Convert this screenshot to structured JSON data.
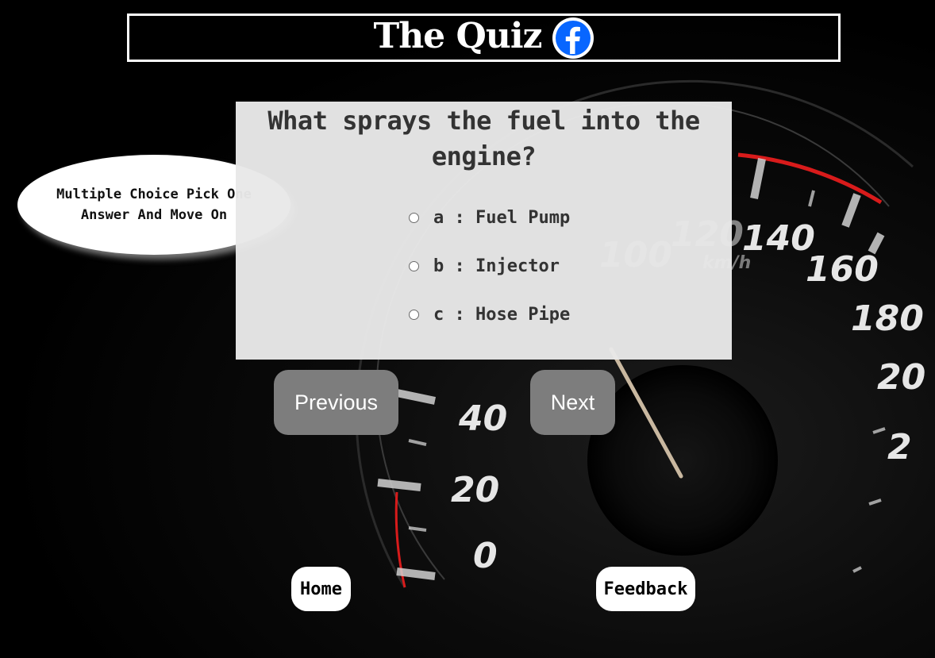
{
  "header": {
    "title": "The Quiz",
    "social_icon": "facebook-icon"
  },
  "instructions": {
    "text": "Multiple Choice Pick One Answer And Move On"
  },
  "question": {
    "text": "What sprays the fuel into the engine?",
    "options": [
      {
        "label": "a : Fuel Pump",
        "selected": false
      },
      {
        "label": "b : Injector",
        "selected": false
      },
      {
        "label": "c : Hose Pipe",
        "selected": false
      }
    ]
  },
  "nav": {
    "previous_label": "Previous",
    "next_label": "Next"
  },
  "footer": {
    "home_label": "Home",
    "feedback_label": "Feedback"
  },
  "colors": {
    "background": "#000000",
    "card": "#e8e8e8",
    "button": "#7d7d7d",
    "facebook_blue": "#0866ff",
    "gauge_red": "#d81b1b"
  }
}
